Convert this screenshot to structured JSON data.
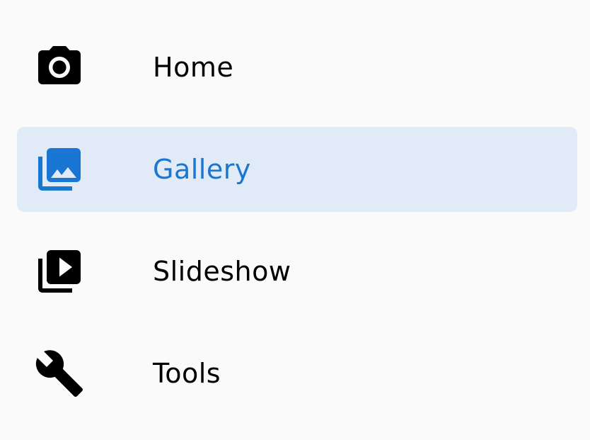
{
  "drawer": {
    "items": [
      {
        "label": "Home",
        "icon": "camera-icon",
        "selected": false
      },
      {
        "label": "Gallery",
        "icon": "photo-library-icon",
        "selected": true
      },
      {
        "label": "Slideshow",
        "icon": "slideshow-icon",
        "selected": false
      },
      {
        "label": "Tools",
        "icon": "wrench-icon",
        "selected": false
      }
    ]
  },
  "colors": {
    "background": "#fafafa",
    "selected_background": "#e1eaf7",
    "accent": "#1976d2",
    "text": "#000000"
  }
}
